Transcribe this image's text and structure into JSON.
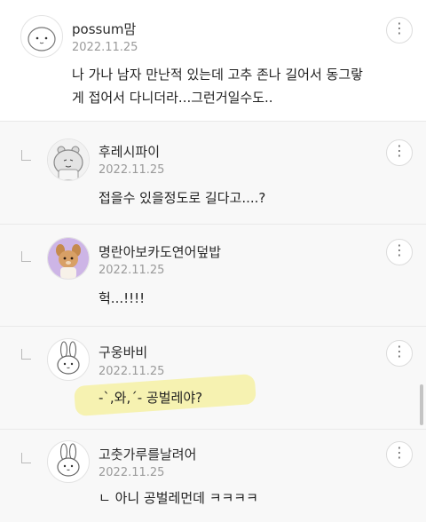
{
  "comments": [
    {
      "nickname": "possum맘",
      "date": "2022.11.25",
      "lines": [
        "나 가나 남자 만난적 있는데 고추 존나 길어서 동그랗",
        "게 접어서 다니더라...그런거일수도.."
      ],
      "avatar_icon": "round-face-avatar-icon",
      "more_icon": "more-options-icon"
    },
    {
      "nickname": "후레시파이",
      "date": "2022.11.25",
      "lines": [
        "접을수 있을정도로 길다고....?"
      ],
      "avatar_icon": "hippo-avatar-icon",
      "more_icon": "more-options-icon"
    },
    {
      "nickname": "명란아보카도연어덮밥",
      "date": "2022.11.25",
      "lines": [
        "헉...!!!!"
      ],
      "avatar_icon": "fawn-avatar-icon",
      "more_icon": "more-options-icon"
    },
    {
      "nickname": "구웅바비",
      "date": "2022.11.25",
      "lines": [
        "-`,와,´- 공벌레야?"
      ],
      "avatar_icon": "bunny-avatar-icon",
      "more_icon": "more-options-icon"
    },
    {
      "nickname": "고춧가루를날려어",
      "date": "2022.11.25",
      "lines": [
        "ㄴ 아니 공벌레먼데 ㅋㅋㅋㅋ"
      ],
      "avatar_icon": "bunny-avatar-icon",
      "more_icon": "more-options-icon"
    }
  ],
  "colors": {
    "reply_bg": "#f8f8f8",
    "highlight": "#f6f1a4",
    "date": "#9a9a9a"
  }
}
